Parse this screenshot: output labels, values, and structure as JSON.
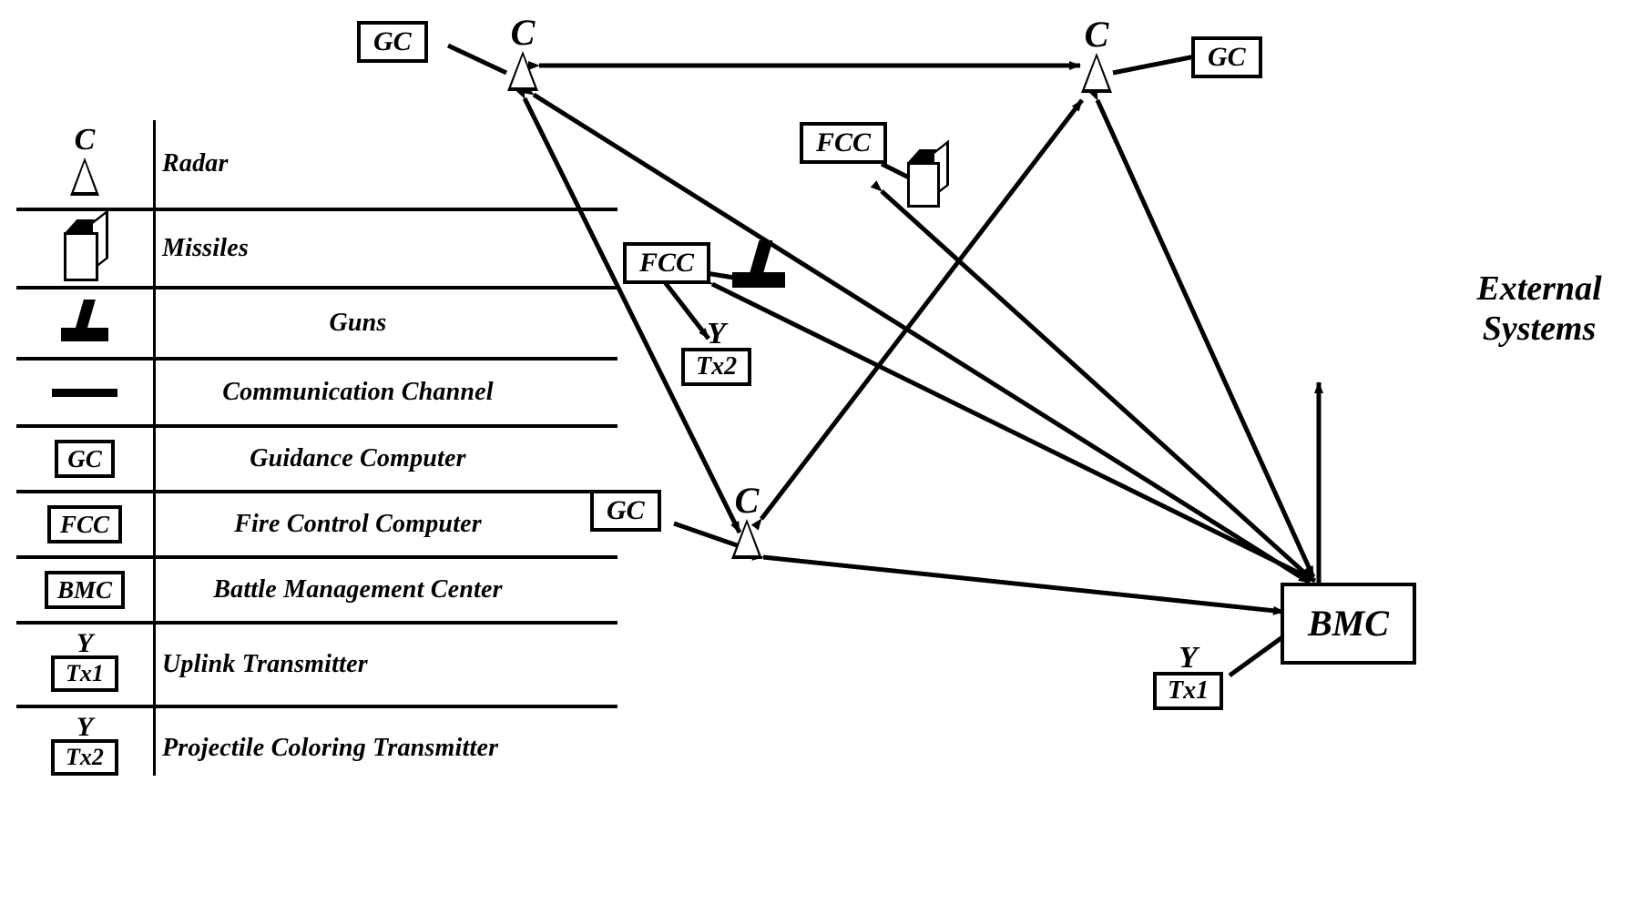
{
  "legend": {
    "rows": [
      {
        "symbol": "radar-symbol",
        "symbol_label": "C",
        "description": "Radar"
      },
      {
        "symbol": "missiles-symbol",
        "symbol_label": "",
        "description": "Missiles"
      },
      {
        "symbol": "guns-symbol",
        "symbol_label": "",
        "description": "Guns"
      },
      {
        "symbol": "communication-channel-symbol",
        "symbol_label": "",
        "description": "Communication Channel"
      },
      {
        "symbol": "gc-box-symbol",
        "symbol_label": "GC",
        "description": "Guidance Computer"
      },
      {
        "symbol": "fcc-box-symbol",
        "symbol_label": "FCC",
        "description": "Fire Control Computer"
      },
      {
        "symbol": "bmc-box-symbol",
        "symbol_label": "BMC",
        "description": "Battle Management Center"
      },
      {
        "symbol": "tx1-symbol",
        "symbol_label": "Tx1",
        "symbol_top": "Y",
        "description": "Uplink Transmitter"
      },
      {
        "symbol": "tx2-symbol",
        "symbol_label": "Tx2",
        "symbol_top": "Y",
        "description": "Projectile Coloring Transmitter"
      }
    ]
  },
  "diagram": {
    "nodes": {
      "radar_top_left": {
        "label": "C"
      },
      "radar_top_right": {
        "label": "C"
      },
      "radar_bottom": {
        "label": "C"
      },
      "gc_top_left": {
        "label": "GC"
      },
      "gc_top_right": {
        "label": "GC"
      },
      "gc_bottom": {
        "label": "GC"
      },
      "fcc_left": {
        "label": "FCC"
      },
      "fcc_right": {
        "label": "FCC"
      },
      "tx2": {
        "top": "Y",
        "label": "Tx2"
      },
      "tx1": {
        "top": "Y",
        "label": "Tx1"
      },
      "bmc": {
        "label": "BMC"
      },
      "external_systems": {
        "label": "External\nSystems",
        "line1": "External",
        "line2": "Systems"
      }
    }
  },
  "colors": {
    "ink": "#000000",
    "background": "#ffffff"
  }
}
